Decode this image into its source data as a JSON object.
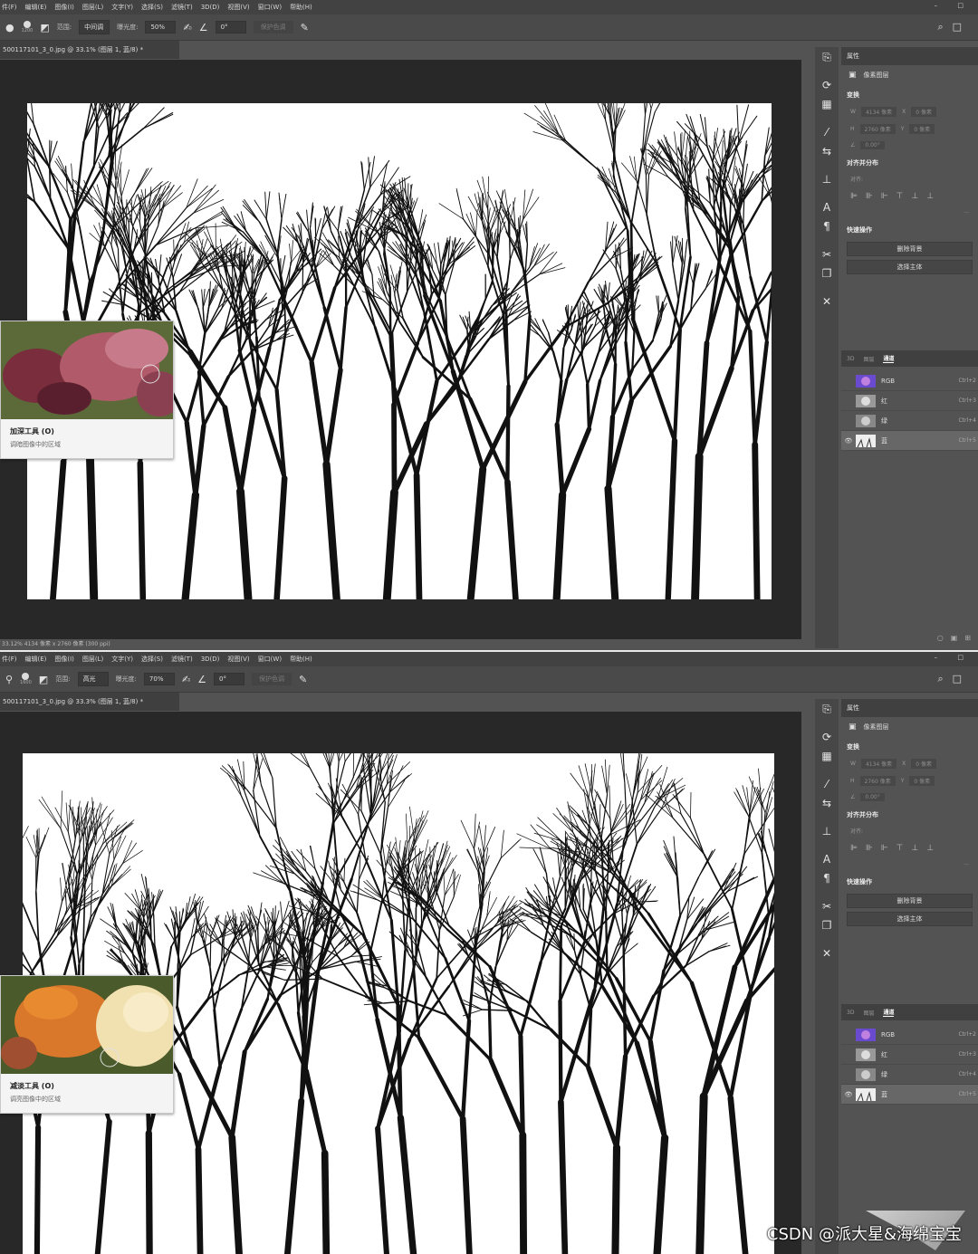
{
  "menu": [
    "件(F)",
    "编辑(E)",
    "图像(I)",
    "图层(L)",
    "文字(Y)",
    "选择(S)",
    "滤镜(T)",
    "3D(D)",
    "视图(V)",
    "窗口(W)",
    "帮助(H)"
  ],
  "window_controls": "– □",
  "top": {
    "options": {
      "brush_size": "1200",
      "range_label": "范围:",
      "range_value": "中间调",
      "exposure_label": "曝光度:",
      "exposure_value": "50%",
      "angle_value": "0°",
      "protect_tones": "保护色调"
    },
    "doc_tab": "500117101_3_0.jpg @ 33.1% (图层 1, 蓝/8) *",
    "status": "33.12%   4134 像素 x 2760 像素 (300 ppi)",
    "tooltip": {
      "title": "加深工具 (O)",
      "desc": "调暗图像中的区域"
    }
  },
  "bottom": {
    "options": {
      "brush_size": "1600",
      "range_label": "范围:",
      "range_value": "高光",
      "exposure_label": "曝光度:",
      "exposure_value": "70%",
      "angle_value": "0°",
      "protect_tones": "保护色调"
    },
    "doc_tab": "500117101_3_0.jpg @ 33.3% (图层 1, 蓝/8) *",
    "tooltip": {
      "title": "减淡工具 (O)",
      "desc": "调亮图像中的区域"
    }
  },
  "properties": {
    "tab": "属性",
    "layer_kind": "像素图层",
    "transform": "变换",
    "w_label": "W",
    "w_value": "4134 像素",
    "h_label": "H",
    "h_value": "2760 像素",
    "x_label": "X",
    "x_value": "0 像素",
    "y_label": "Y",
    "y_value": "0 像素",
    "angle_value": "0.00°",
    "align_section": "对齐并分布",
    "align_label": "对齐:",
    "more": "···",
    "quick_actions": "快速操作",
    "remove_bg": "删除背景",
    "select_subject": "选择主体"
  },
  "channel_tabs": [
    "3D",
    "图层",
    "通道"
  ],
  "channels": [
    {
      "name": "RGB",
      "shortcut": "Ctrl+2"
    },
    {
      "name": "红",
      "shortcut": "Ctrl+3"
    },
    {
      "name": "绿",
      "shortcut": "Ctrl+4"
    },
    {
      "name": "蓝",
      "shortcut": "Ctrl+5"
    }
  ],
  "watermark": "CSDN @派大星&海绵宝宝",
  "icons": [
    "dodge-tool-icon",
    "brush-icon",
    "search-icon",
    "eye-icon",
    "history-icon",
    "3d-rotate-icon",
    "grid-icon",
    "type-icon",
    "paragraph-icon",
    "scissors-icon",
    "close-x-icon",
    "image-icon"
  ],
  "colors": {
    "ui_dark": "#282828",
    "ui_panel": "#535353",
    "selected_row": "#676767"
  }
}
